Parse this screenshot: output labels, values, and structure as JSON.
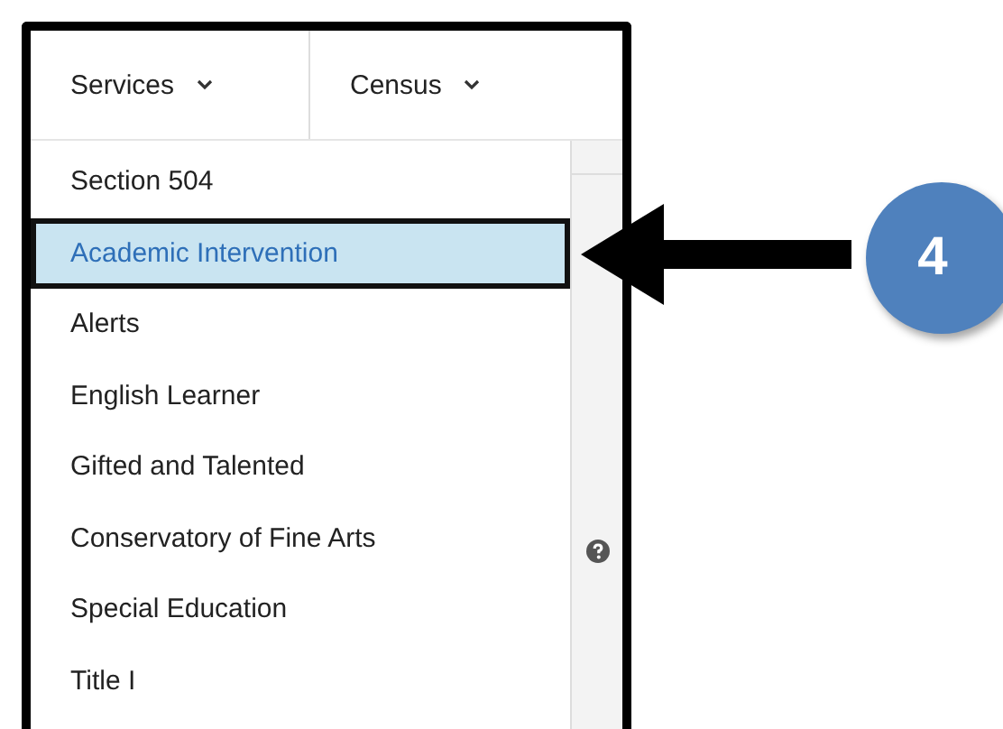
{
  "nav": {
    "tabs": [
      {
        "label": "Services"
      },
      {
        "label": "Census"
      }
    ]
  },
  "menu": {
    "items": [
      {
        "label": "Section 504",
        "selected": false
      },
      {
        "label": "Academic Intervention",
        "selected": true
      },
      {
        "label": "Alerts",
        "selected": false
      },
      {
        "label": "English Learner",
        "selected": false
      },
      {
        "label": "Gifted and Talented",
        "selected": false
      },
      {
        "label": "Conservatory of Fine Arts",
        "selected": false
      },
      {
        "label": "Special Education",
        "selected": false
      },
      {
        "label": "Title I",
        "selected": false
      }
    ]
  },
  "callout": {
    "step": "4"
  }
}
